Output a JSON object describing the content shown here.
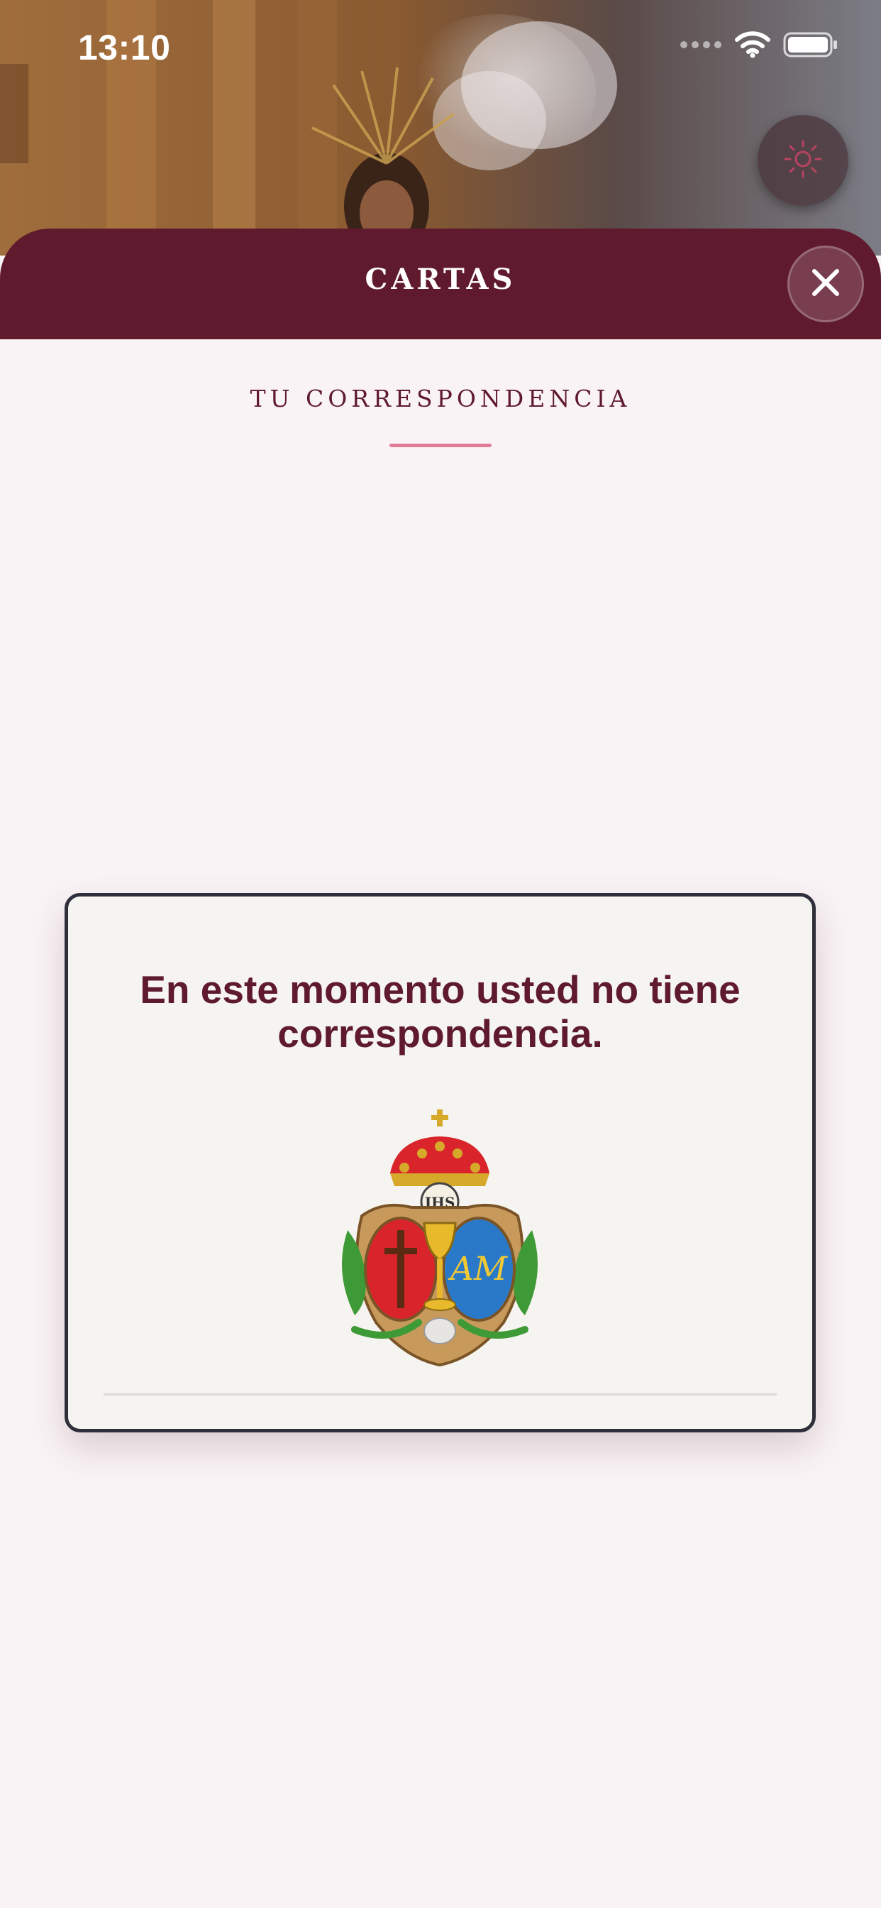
{
  "status_bar": {
    "time": "13:10",
    "icons": [
      "signal-dots-icon",
      "wifi-icon",
      "battery-icon"
    ]
  },
  "theme_toggle": {
    "icon": "sun-icon"
  },
  "header": {
    "title": "CARTAS",
    "close_icon": "close-icon"
  },
  "section": {
    "title": "TU CORRESPONDENCIA"
  },
  "empty_state": {
    "message": "En este momento usted no tiene correspondencia.",
    "image": "brotherhood-crest"
  },
  "colors": {
    "brand": "#5f1a2e",
    "accent": "#e27b96",
    "background": "#faf3f5",
    "card": "#f5f4f1"
  }
}
